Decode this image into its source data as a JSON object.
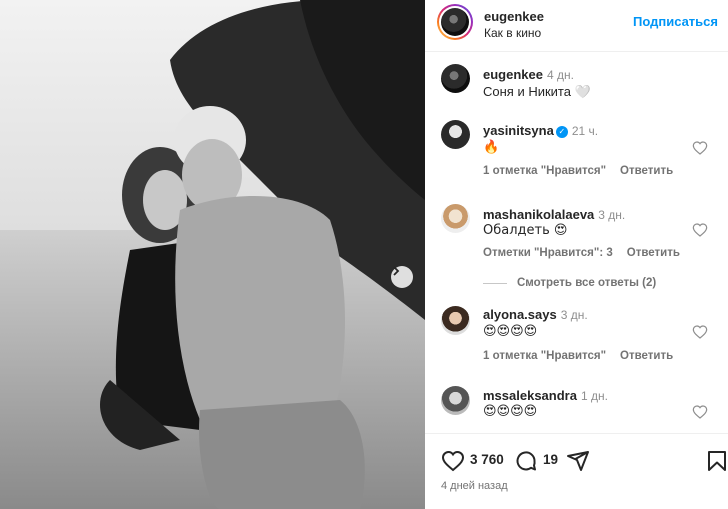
{
  "post": {
    "author": "eugenkee",
    "location": "Как в кино",
    "follow_label": "Подписаться",
    "caption": {
      "user": "eugenkee",
      "time": "4 дн.",
      "text": "Соня и Никита 🤍"
    }
  },
  "comments": [
    {
      "user": "yasinitsyna",
      "verified": true,
      "verified_mark": "✓",
      "time": "21 ч.",
      "text": "🔥",
      "likes_label": "1 отметка \"Нравится\"",
      "reply_label": "Ответить"
    },
    {
      "user": "mashanikolalaeva",
      "verified": false,
      "time": "3 дн.",
      "text": "Обалдеть 😍",
      "likes_label": "Отметки \"Нравится\": 3",
      "reply_label": "Ответить",
      "view_replies": "Смотреть все ответы (2)"
    },
    {
      "user": "alyona.says",
      "verified": false,
      "time": "3 дн.",
      "text": "😍😍😍😍",
      "likes_label": "1 отметка \"Нравится\"",
      "reply_label": "Ответить"
    },
    {
      "user": "mssaleksandra",
      "verified": false,
      "time": "1 дн.",
      "text": "😍😍😍😍"
    }
  ],
  "footer": {
    "likes_count": "3 760",
    "comments_count": "19",
    "date": "4 дней назад"
  },
  "icons": {
    "like": "heart-icon",
    "comment": "comment-icon",
    "share": "share-icon",
    "save": "bookmark-icon",
    "next": "chevron-right-icon"
  },
  "colors": {
    "accent": "#0095f6",
    "text": "#262626",
    "muted": "#737373"
  }
}
